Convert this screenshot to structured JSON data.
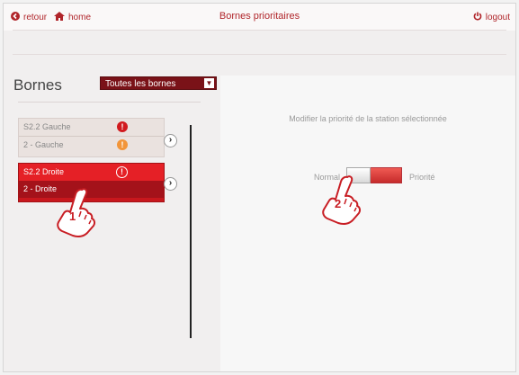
{
  "topbar": {
    "back_label": "retour",
    "home_label": "home",
    "title": "Bornes prioritaires",
    "logout_label": "logout"
  },
  "panel": {
    "title": "Bornes",
    "filter_value": "Toutes les bornes"
  },
  "stations": [
    {
      "name": "S2.2 Gauche",
      "sub": "2 - Gauche",
      "status_icon": "alert-red-icon",
      "sub_icon": "alert-orange-icon",
      "selected": false
    },
    {
      "name": "S2.2 Droite",
      "sub": "2 - Droite",
      "status_icon": "alert-outline-icon",
      "selected": true
    }
  ],
  "detail": {
    "instruction": "Modifier la priorité de la station sélectionnée",
    "toggle_off_label": "Normal",
    "toggle_on_label": "Priorité",
    "priority": true
  },
  "annotations": [
    "1",
    "2"
  ],
  "colors": {
    "accent": "#b0252a",
    "active_red": "#e52026",
    "dark_red": "#7a1218"
  }
}
